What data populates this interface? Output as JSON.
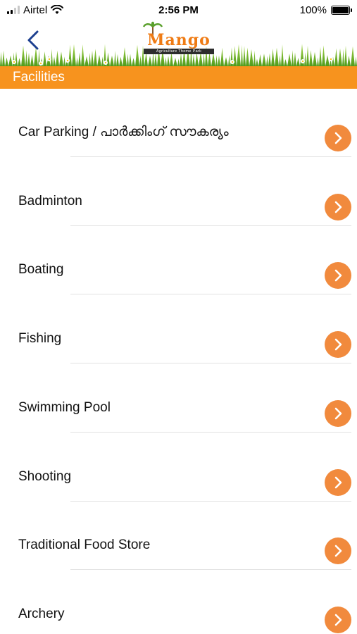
{
  "status_bar": {
    "carrier": "Airtel",
    "time": "2:56 PM",
    "battery": "100%"
  },
  "header": {
    "logo_title": "Mango",
    "logo_subtitle": "Agriculture Theme Park"
  },
  "page": {
    "title": "Facilities"
  },
  "facilities": [
    {
      "label": "Car Parking / പാർക്കിംഗ് സൗകര്യം"
    },
    {
      "label": "Badminton"
    },
    {
      "label": "Boating"
    },
    {
      "label": "Fishing"
    },
    {
      "label": "Swimming Pool"
    },
    {
      "label": "Shooting"
    },
    {
      "label": "Traditional Food Store"
    },
    {
      "label": "Archery"
    }
  ],
  "colors": {
    "accent": "#f7931e",
    "chevron": "#f18a3d",
    "back": "#1c3f8f"
  }
}
